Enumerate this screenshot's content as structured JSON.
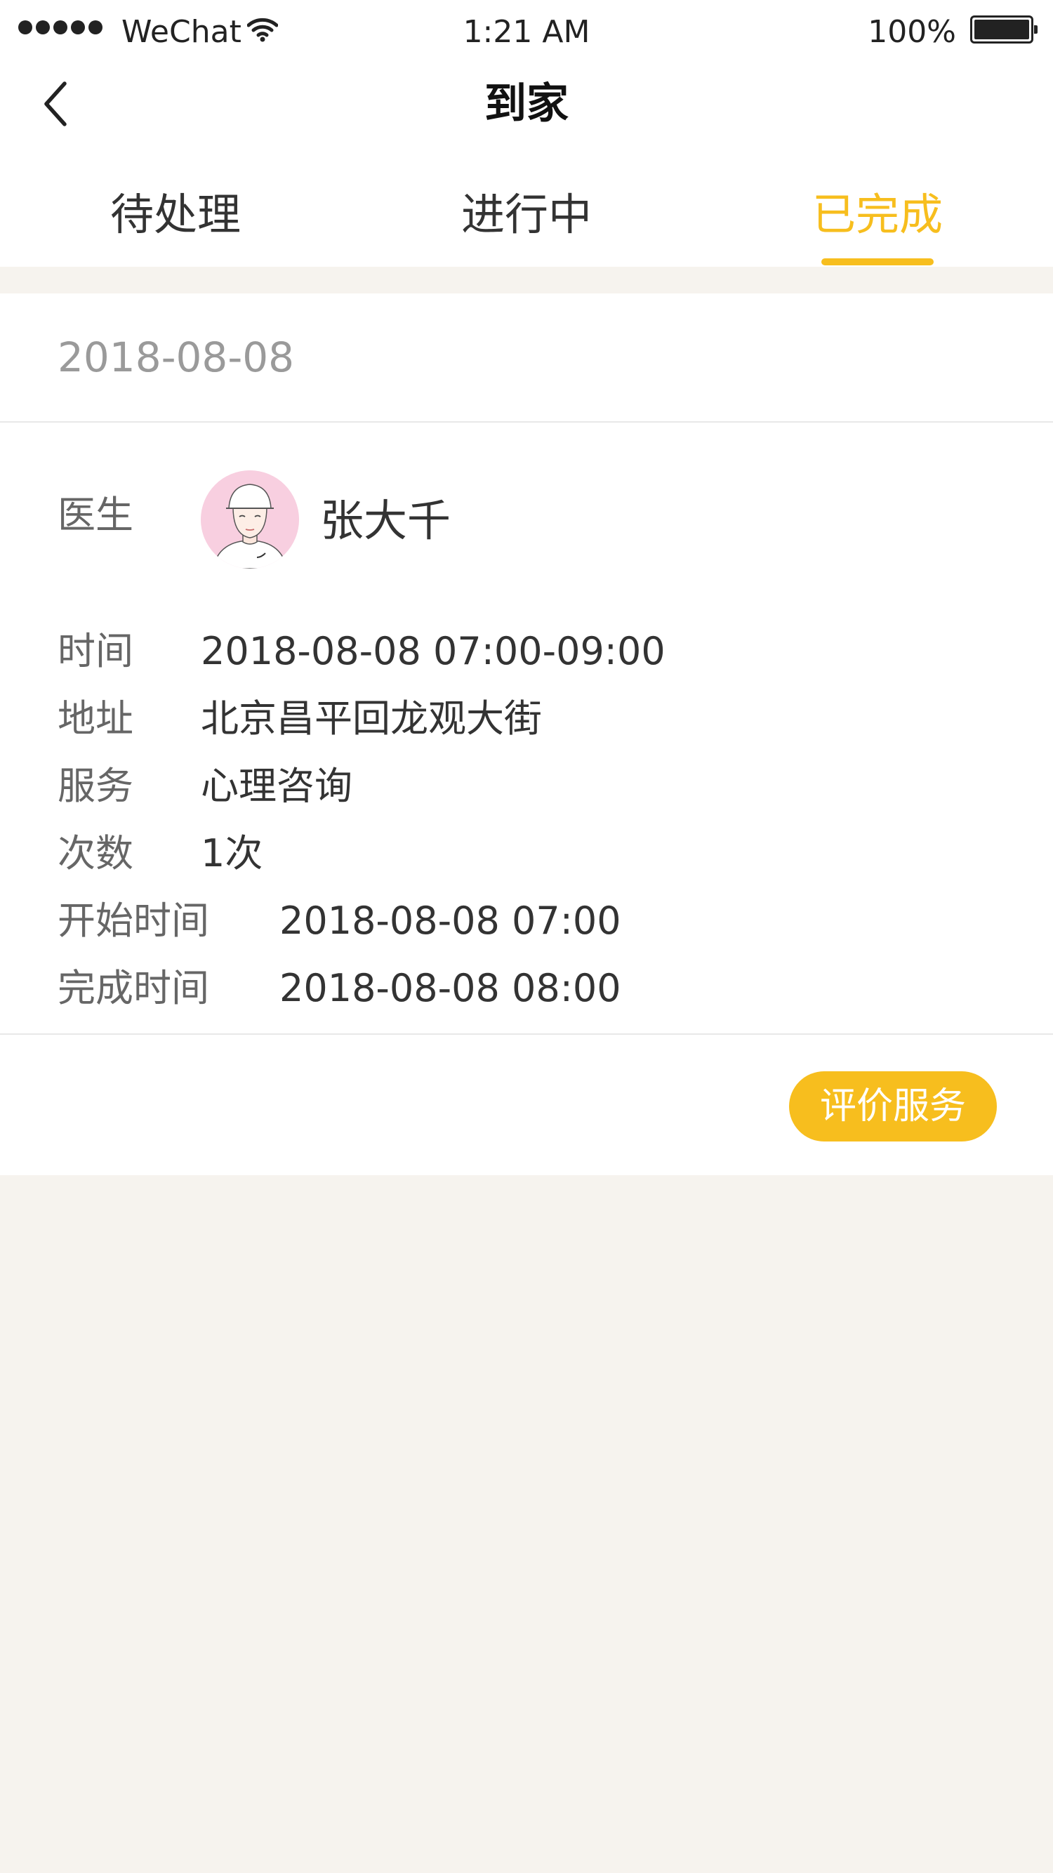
{
  "status_bar": {
    "carrier": "WeChat",
    "time": "1:21 AM",
    "battery": "100%",
    "signal_icon": "signal-dots-icon",
    "wifi_icon": "wifi-icon",
    "battery_icon": "battery-full-icon"
  },
  "nav": {
    "title": "到家",
    "back_icon": "chevron-left-icon"
  },
  "tabs": [
    {
      "label": "待处理",
      "active": false
    },
    {
      "label": "进行中",
      "active": false
    },
    {
      "label": "已完成",
      "active": true
    }
  ],
  "order": {
    "date": "2018-08-08",
    "doctor_label": "医生",
    "doctor_name": "张大千",
    "details": [
      {
        "label": "时间",
        "value": "2018-08-08 07:00-09:00"
      },
      {
        "label": "地址",
        "value": "北京昌平回龙观大街"
      },
      {
        "label": "服务",
        "value": "心理咨询"
      },
      {
        "label": "次数",
        "value": "1次"
      },
      {
        "label": "开始时间",
        "value": "2018-08-08 07:00"
      },
      {
        "label": "完成时间",
        "value": "2018-08-08 08:00"
      }
    ],
    "action_label": "评价服务"
  },
  "colors": {
    "accent": "#f7be1e",
    "page_background": "#f6f3ee",
    "card_background": "#ffffff",
    "muted_text": "#9a9a9a"
  }
}
